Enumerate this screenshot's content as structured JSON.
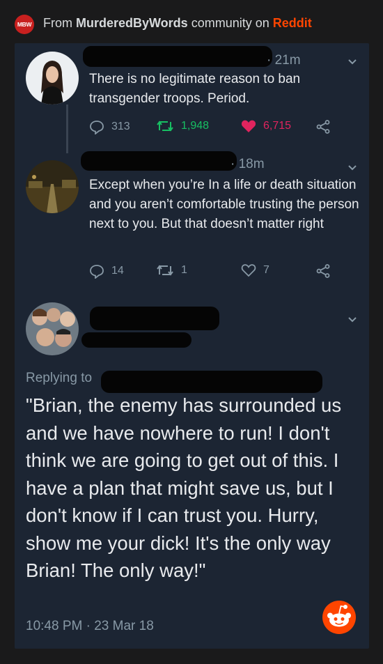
{
  "header": {
    "icon_text": "MBW",
    "prefix": "From ",
    "subreddit": "MurderedByWords",
    "middle": " community on ",
    "platform": "Reddit"
  },
  "tweets": [
    {
      "time": "· 21m",
      "text": "There is no legitimate reason to ban transgender troops. Period.",
      "replies": "313",
      "retweets": "1,948",
      "likes": "6,715"
    },
    {
      "time": "· 18m",
      "text": "Except when you’re In a life or death situation and you aren’t comfortable trusting the person next to you. But that doesn’t matter right",
      "replies": "14",
      "retweets": "1",
      "likes": "7"
    }
  ],
  "main_tweet": {
    "replying_prefix": "Replying to",
    "text": "\"Brian, the enemy has surrounded us and we have nowhere to run! I don't think we are going to get out of this. I have a plan that might save us, but I don't know if I can trust you. Hurry, show me your dick! It's the only way Brian! The only way!\"",
    "timestamp": "10:48 PM · 23 Mar 18"
  },
  "colors": {
    "background": "#1a1a1b",
    "card": "#1c2533",
    "reddit_orange": "#ff4500",
    "retweet_green": "#17bf63",
    "like_pink": "#e0245e",
    "muted": "#8899a6"
  }
}
